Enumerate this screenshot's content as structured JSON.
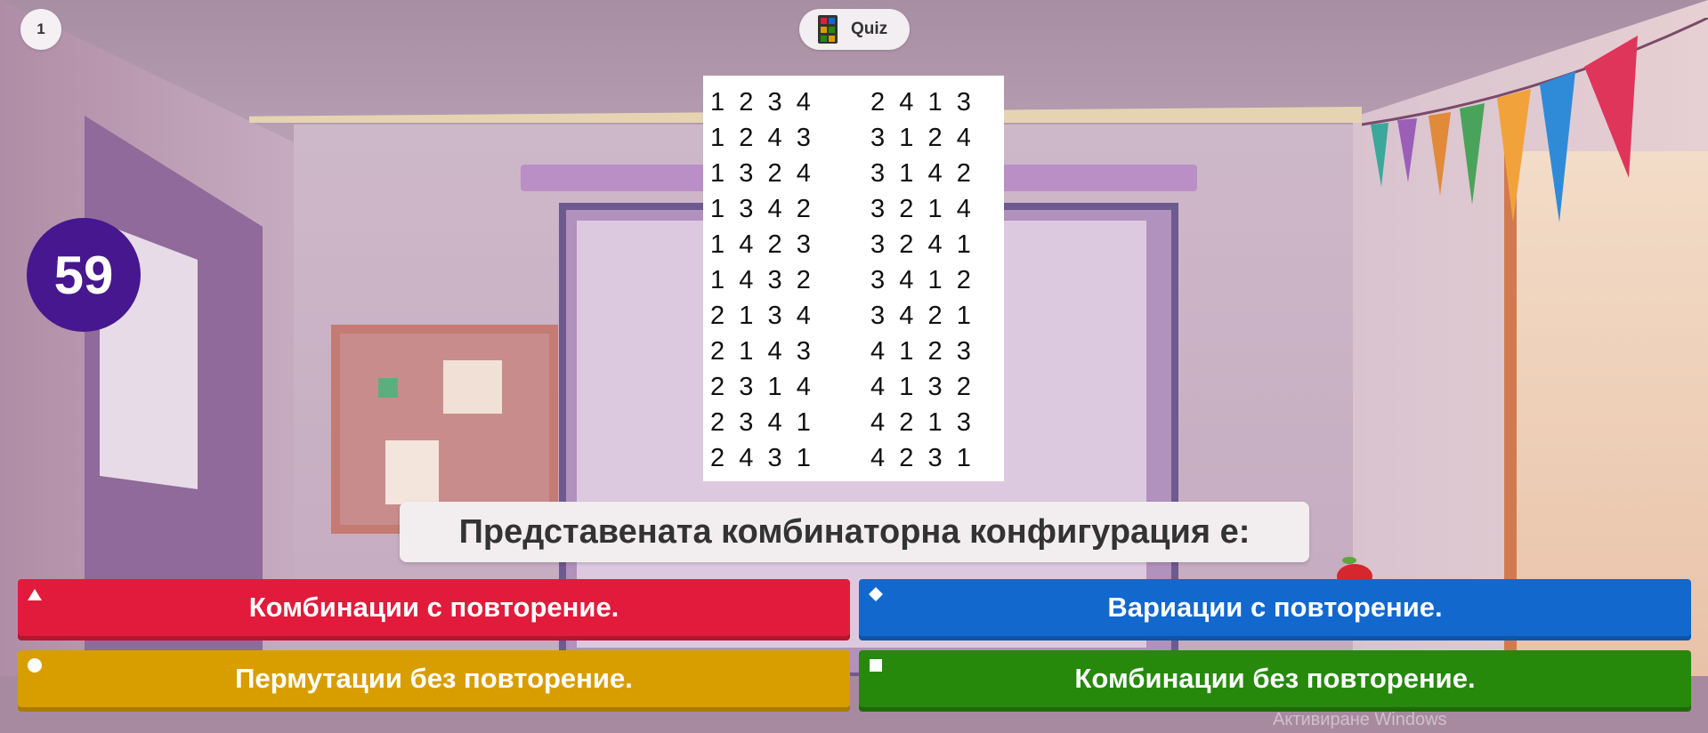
{
  "header": {
    "question_counter": "1",
    "mode_label": "Quiz",
    "mode_icon": "quiz-grid-icon"
  },
  "timer": {
    "seconds": "59",
    "color": "#46178f"
  },
  "question_image": {
    "left_column": [
      "1  2  3  4",
      "1  2  4  3",
      "1  3  2  4",
      "1  3  4  2",
      "1  4  2  3",
      "1  4  3  2",
      "2  1  3  4",
      "2  1  4  3",
      "2  3  1  4",
      "2  3  4  1",
      "2  4  3  1"
    ],
    "right_column": [
      "2  4  1  3",
      "3  1  2  4",
      "3  1  4  2",
      "3  2  1  4",
      "3  2  4  1",
      "3  4  1  2",
      "3  4  2  1",
      "4  1  2  3",
      "4  1  3  2",
      "4  2  1  3",
      "4  2  3  1"
    ]
  },
  "question": {
    "text": "Представената комбинаторна конфигурация е:"
  },
  "answers": [
    {
      "label": "Комбинации с повторение.",
      "shape": "triangle-icon",
      "color": "#e21b3c"
    },
    {
      "label": "Вариации с повторение.",
      "shape": "diamond-icon",
      "color": "#1368ce"
    },
    {
      "label": "Пермутации без повторение.",
      "shape": "circle-icon",
      "color": "#d89e00"
    },
    {
      "label": "Комбинации без повторение.",
      "shape": "square-icon",
      "color": "#26890c"
    }
  ],
  "watermark": "Активиране Windows"
}
